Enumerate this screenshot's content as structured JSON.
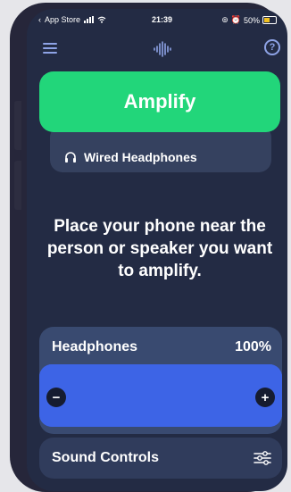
{
  "status_bar": {
    "back_app": "App Store",
    "time": "21:39",
    "battery": "50%",
    "icons": [
      "back-arrow-icon",
      "signal-bars-icon",
      "wifi-icon",
      "rotation-lock-icon",
      "alarm-icon",
      "battery-charging-icon"
    ]
  },
  "header": {
    "menu_icon": "hamburger-menu-icon",
    "logo_icon": "sound-wave-icon",
    "help_label": "?"
  },
  "amplify": {
    "label": "Amplify",
    "color": "#22d67a"
  },
  "output_device": {
    "icon": "headphones-icon",
    "label": "Wired Headphones"
  },
  "instruction": "Place your phone near the person or speaker you want to amplify.",
  "volume": {
    "label": "Headphones",
    "percent_label": "100%",
    "level": 1.0,
    "decrease_label": "−",
    "increase_label": "+",
    "slider_color": "#3d64e6"
  },
  "sound_controls": {
    "label": "Sound Controls",
    "icon": "sliders-icon"
  }
}
